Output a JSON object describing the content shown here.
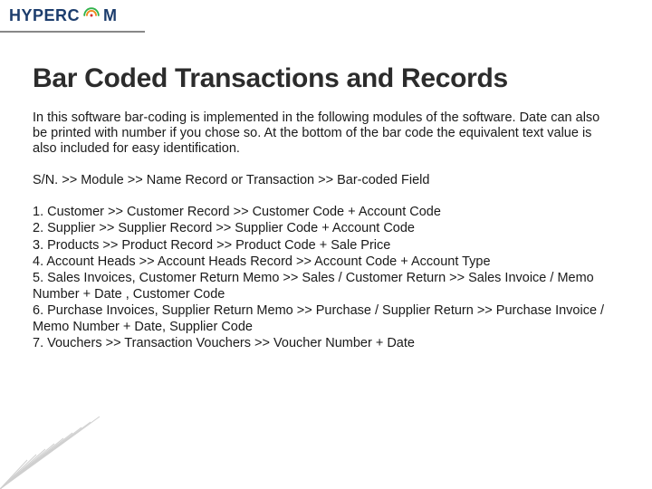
{
  "logo": {
    "text": "HYPERC",
    "text2": "M"
  },
  "title": "Bar Coded Transactions and Records",
  "intro": "In this software bar-coding is implemented in the following modules of the software. Date can also be printed with number if you chose so. At the bottom of the bar code the equivalent text value is also included for easy identification.",
  "header_row": "S/N. >> Module >> Name Record or Transaction >> Bar-coded Field",
  "items": [
    "1. Customer >> Customer Record >> Customer Code + Account Code",
    "2. Supplier >> Supplier Record >> Supplier Code + Account Code",
    "3. Products >> Product Record >> Product Code + Sale Price",
    "4. Account Heads >> Account Heads Record >> Account Code + Account Type",
    "5. Sales Invoices, Customer Return Memo >> Sales / Customer Return >> Sales Invoice / Memo Number + Date , Customer Code",
    "6. Purchase Invoices, Supplier Return Memo >> Purchase / Supplier Return >> Purchase Invoice / Memo Number + Date, Supplier Code",
    "7. Vouchers >> Transaction Vouchers >> Voucher Number + Date"
  ]
}
